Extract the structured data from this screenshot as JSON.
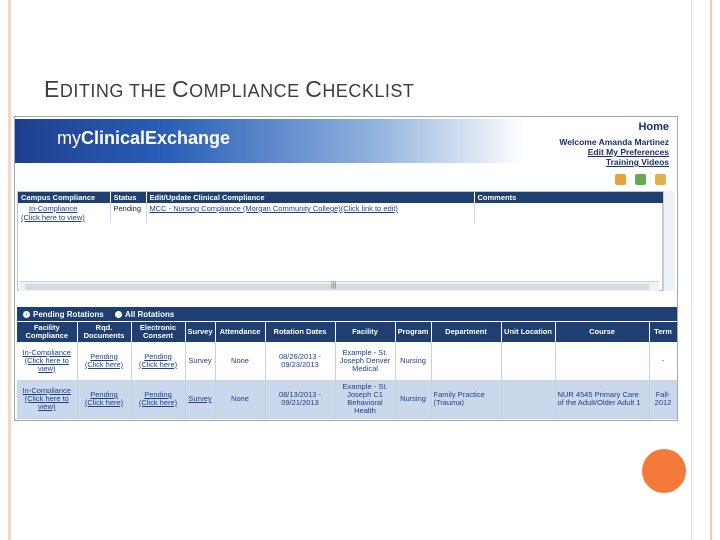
{
  "slide": {
    "title_parts": [
      {
        "text": "E",
        "big": true
      },
      {
        "text": "DITING THE ",
        "big": false
      },
      {
        "text": "C",
        "big": true
      },
      {
        "text": "OMPLIANCE ",
        "big": false
      },
      {
        "text": "C",
        "big": true
      },
      {
        "text": "HECKLIST",
        "big": false
      }
    ],
    "accent_color": "#f47a3c"
  },
  "app": {
    "logo_prefix": "my",
    "logo_main": "ClinicalExchange",
    "home": "Home",
    "welcome": "Welcome Amanda Martinez",
    "edit_prefs": "Edit My Preferences",
    "training": "Training Videos",
    "toolbar_icons": [
      "home-icon",
      "refresh-icon",
      "help-icon"
    ]
  },
  "compliance_table": {
    "headers": [
      "Campus Compliance",
      "Status",
      "Edit/Update Clinical Compliance",
      "Comments"
    ],
    "row": {
      "campus": "In-Compliance",
      "campus_link": "(Click here to view)",
      "status": "Pending",
      "edit": "MCC - Nursing Compliance (Morgan Community College)(Click link to edit)",
      "comments": ""
    }
  },
  "rotations": {
    "pending_label": "Pending Rotations",
    "all_label": "All Rotations",
    "headers": [
      "Facility Compliance",
      "Rqd. Documents",
      "Electronic Consent",
      "Survey",
      "Attendance",
      "Rotation Dates",
      "Facility",
      "Program",
      "Department",
      "Unit Location",
      "Course",
      "Term"
    ],
    "rows": [
      {
        "facility_compliance": "In-Compliance",
        "facility_compliance_link": "(Click here to view)",
        "documents": "Pending",
        "documents_link": "(Click here)",
        "consent": "Pending",
        "consent_link": "(Click here)",
        "survey": "Survey",
        "attendance": "None",
        "dates": "08/26/2013 - 09/23/2013",
        "facility": "Example - St. Joseph Denver Medical",
        "program": "Nursing",
        "department": "",
        "unit": "",
        "course": "",
        "term": "-"
      },
      {
        "facility_compliance": "In-Compliance",
        "facility_compliance_link": "(Click here to view)",
        "documents": "Pending",
        "documents_link": "(Click here)",
        "consent": "Pending",
        "consent_link": "(Click here)",
        "survey": "Survey",
        "attendance": "None",
        "dates": "08/13/2013 - 09/21/2013",
        "facility": "Example - St. Joseph C1 Behavioral Health",
        "program": "Nursing",
        "department": "Family Practice (Trauma)",
        "unit": "",
        "course": "NUR 4545 Primary Care of the Adult/Older Adult 1",
        "term": "Fall-2012"
      }
    ]
  }
}
